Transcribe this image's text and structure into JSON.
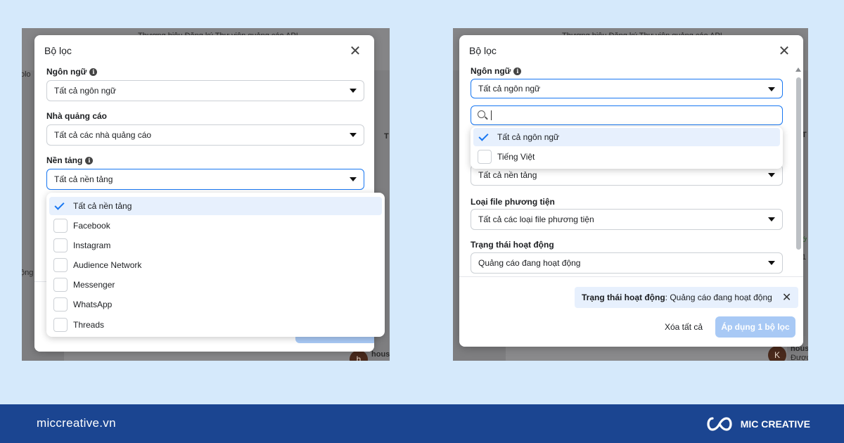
{
  "left": {
    "bg_texts": {
      "top": "Thương hiệu  Đăng ký  Thư viện quảng cáo  API",
      "side": "olo",
      "r1": "T",
      "r2": "ộng",
      "r3": "hous"
    },
    "avatar_letter": "h",
    "dialog": {
      "title": "Bộ lọc",
      "fields": [
        {
          "label": "Ngôn ngữ",
          "value": "Tất cả ngôn ngữ"
        },
        {
          "label": "Nhà quảng cáo",
          "value": "Tất cả các nhà quảng cáo"
        },
        {
          "label": "Nền tảng",
          "value": "Tất cả nền tảng"
        }
      ],
      "options": [
        {
          "label": "Tất cả nền tảng",
          "checked": true
        },
        {
          "label": "Facebook",
          "checked": false
        },
        {
          "label": "Instagram",
          "checked": false
        },
        {
          "label": "Audience Network",
          "checked": false
        },
        {
          "label": "Messenger",
          "checked": false
        },
        {
          "label": "WhatsApp",
          "checked": false
        },
        {
          "label": "Threads",
          "checked": false
        }
      ],
      "apply_partial": "c"
    }
  },
  "right": {
    "bg_texts": {
      "top": "Thương hiệu  Đăng ký  Thư viện quảng cáo  API",
      "r1": "T",
      "r2": "ớ",
      "r3": "1",
      "r4": "hous",
      "r5": "Được"
    },
    "avatar_letter": "K",
    "dialog": {
      "title": "Bộ lọc",
      "fields": [
        {
          "label": "Ngôn ngữ",
          "value": "Tất cả ngôn ngữ"
        },
        {
          "label": "",
          "value": "Tất cả nền tảng"
        },
        {
          "label": "Loại file phương tiện",
          "value": "Tất cả các loại file phương tiện"
        },
        {
          "label": "Trạng thái hoạt động",
          "value": "Quảng cáo đang hoạt động"
        }
      ],
      "search_value": "",
      "options": [
        {
          "label": "Tất cả ngôn ngữ",
          "checked": true
        },
        {
          "label": "Tiếng Việt",
          "checked": false
        }
      ],
      "chip": {
        "key": "Trạng thái hoạt động",
        "value": ": Quảng cáo đang hoạt động"
      },
      "clear_label": "Xóa tất cả",
      "apply_label": "Áp dụng 1 bộ lọc"
    }
  },
  "footer": {
    "site": "miccreative.vn",
    "brand": "MIC CREATIVE"
  },
  "colors": {
    "accent": "#1877f2",
    "bar": "#1b4591",
    "page_bg": "#d5e9fb"
  }
}
